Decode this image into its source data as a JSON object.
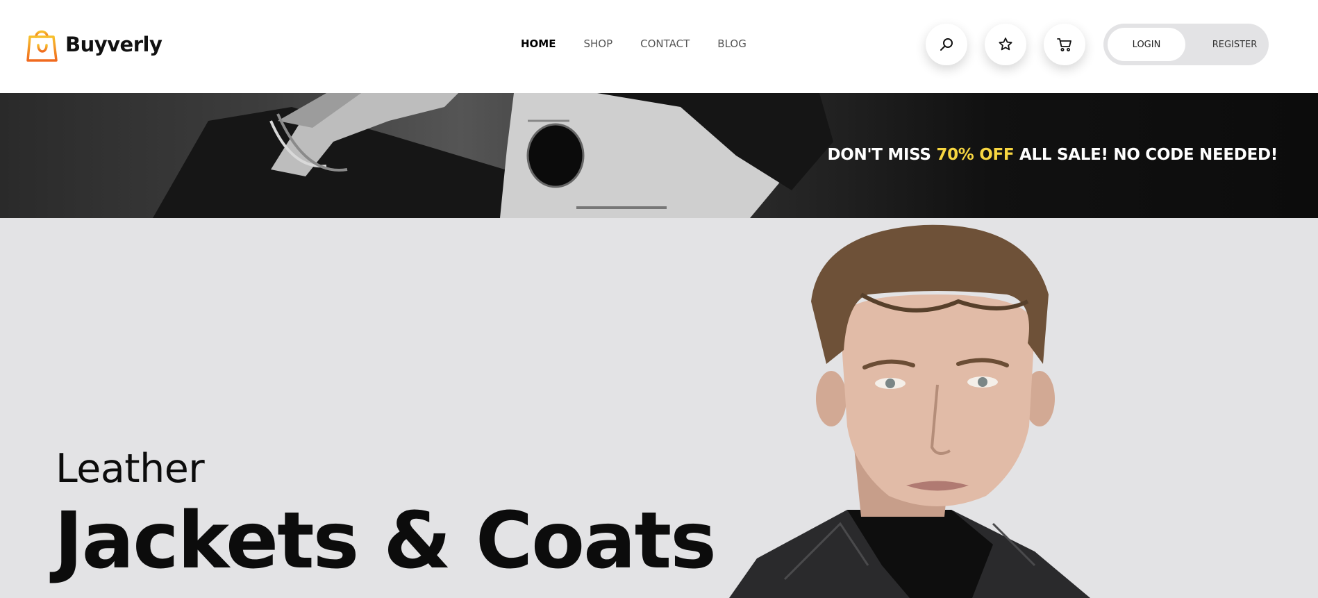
{
  "brand": {
    "name": "Buyverly"
  },
  "nav": {
    "items": [
      {
        "label": "HOME",
        "active": true
      },
      {
        "label": "SHOP",
        "active": false
      },
      {
        "label": "CONTACT",
        "active": false
      },
      {
        "label": "BLOG",
        "active": false
      }
    ]
  },
  "actions": {
    "icons": [
      "search-icon",
      "star-icon",
      "cart-icon"
    ],
    "login_label": "LOGIN",
    "register_label": "REGISTER"
  },
  "banner": {
    "text_before": "DON'T MISS ",
    "highlight": "70% OFF",
    "text_after": " ALL SALE! NO CODE NEEDED!",
    "highlight_color": "#f7d641"
  },
  "hero": {
    "subtitle": "Leather",
    "title": "Jackets & Coats"
  }
}
